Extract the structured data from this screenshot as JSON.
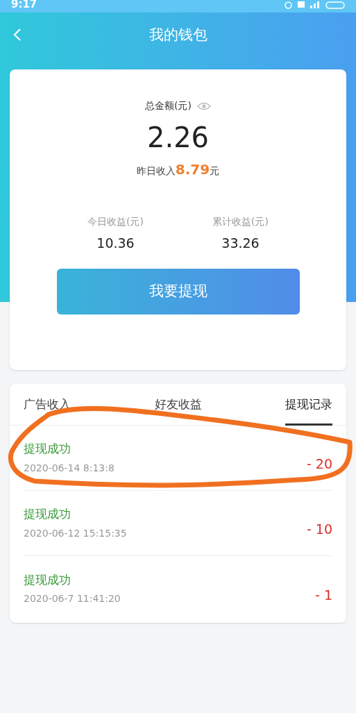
{
  "status_bar": {
    "time": "9:17"
  },
  "header": {
    "title": "我的钱包"
  },
  "wallet": {
    "total_label": "总金额(元)",
    "total": "2.26",
    "yesterday_label": "昨日收入",
    "yesterday_amount": "8.79",
    "yesterday_unit": "元",
    "stats": [
      {
        "label": "今日收益(元)",
        "value": "10.36"
      },
      {
        "label": "累计收益(元)",
        "value": "33.26"
      }
    ],
    "button": "我要提现"
  },
  "tabs": [
    {
      "label": "广告收入",
      "selected": false
    },
    {
      "label": "好友收益",
      "selected": false
    },
    {
      "label": "提现记录",
      "selected": true
    }
  ],
  "records": [
    {
      "status": "提现成功",
      "time": "2020-06-14 8:13:8",
      "amount": "- 20"
    },
    {
      "status": "提现成功",
      "time": "2020-06-12 15:15:35",
      "amount": "- 10"
    },
    {
      "status": "提现成功",
      "time": "2020-06-7 11:41:20",
      "amount": "- 1"
    }
  ]
}
